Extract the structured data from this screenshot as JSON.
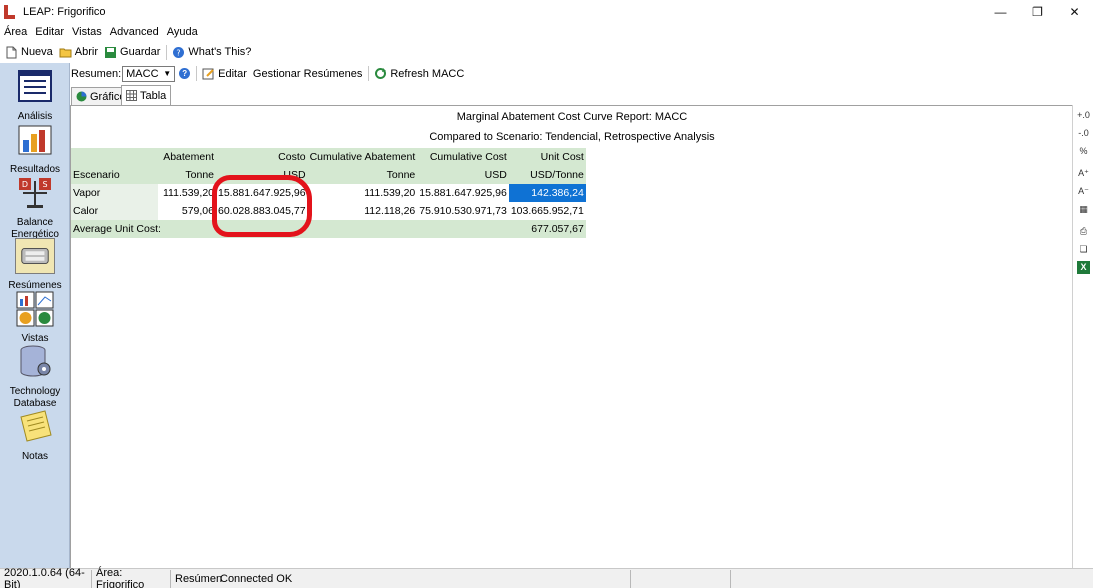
{
  "window": {
    "title": "LEAP: Frigorifico",
    "minimize_glyph": "—",
    "restore_glyph": "❐",
    "close_glyph": "✕"
  },
  "menu": [
    "Área",
    "Editar",
    "Vistas",
    "Advanced",
    "Ayuda"
  ],
  "toolbar": {
    "nueva": "Nueva",
    "abrir": "Abrir",
    "guardar": "Guardar",
    "whats_this": "What's This?"
  },
  "sidebar": {
    "items": [
      {
        "label": "Análisis",
        "icon": "analysis-icon"
      },
      {
        "label": "Resultados",
        "icon": "results-icon"
      },
      {
        "label": "Balance Energético",
        "icon": "energy-balance-icon"
      },
      {
        "label": "Resúmenes",
        "icon": "summaries-icon",
        "selected": true
      },
      {
        "label": "Vistas",
        "icon": "views-icon"
      },
      {
        "label": "Technology Database",
        "icon": "database-icon"
      },
      {
        "label": "Notas",
        "icon": "notes-icon"
      }
    ]
  },
  "subtoolbar": {
    "resumen_label": "Resumen:",
    "resumen_value": "MACC",
    "editar": "Editar",
    "gestionar": "Gestionar Resúmenes",
    "refresh": "Refresh MACC"
  },
  "tabs": [
    {
      "label": "Gráfico",
      "active": false
    },
    {
      "label": "Tabla",
      "active": true
    }
  ],
  "report": {
    "title": "Marginal Abatement Cost Curve Report: MACC",
    "subtitle": "Compared to Scenario: Tendencial, Retrospective Analysis"
  },
  "table": {
    "headers": [
      "",
      "Abatement",
      "Costo",
      "Cumulative Abatement",
      "Cumulative Cost",
      "Unit Cost"
    ],
    "units": [
      "Escenario",
      "Tonne",
      "USD",
      "Tonne",
      "USD",
      "USD/Tonne"
    ],
    "rows": [
      {
        "name": "Vapor",
        "abatement": "111.539,20",
        "costo": "15.881.647.925,96",
        "cum_abatement": "111.539,20",
        "cum_cost": "15.881.647.925,96",
        "unit_cost": "142.386,24"
      },
      {
        "name": "Calor",
        "abatement": "579,06",
        "costo": "60.028.883.045,77",
        "cum_abatement": "112.118,26",
        "cum_cost": "75.910.530.971,73",
        "unit_cost": "103.665.952,71"
      }
    ],
    "average_label": "Average Unit Cost:",
    "average_value": "677.057,67"
  },
  "statusbar": {
    "version": "2020.1.0.64 (64-Bit)",
    "area": "Área: Frigorifico",
    "view": "Resúmen",
    "status": "Connected OK"
  },
  "colors": {
    "sidebar_bg": "#c9d9ec",
    "header_bg": "#d4e8d1",
    "selection": "#0f72d4",
    "markup_red": "#e3131b"
  }
}
